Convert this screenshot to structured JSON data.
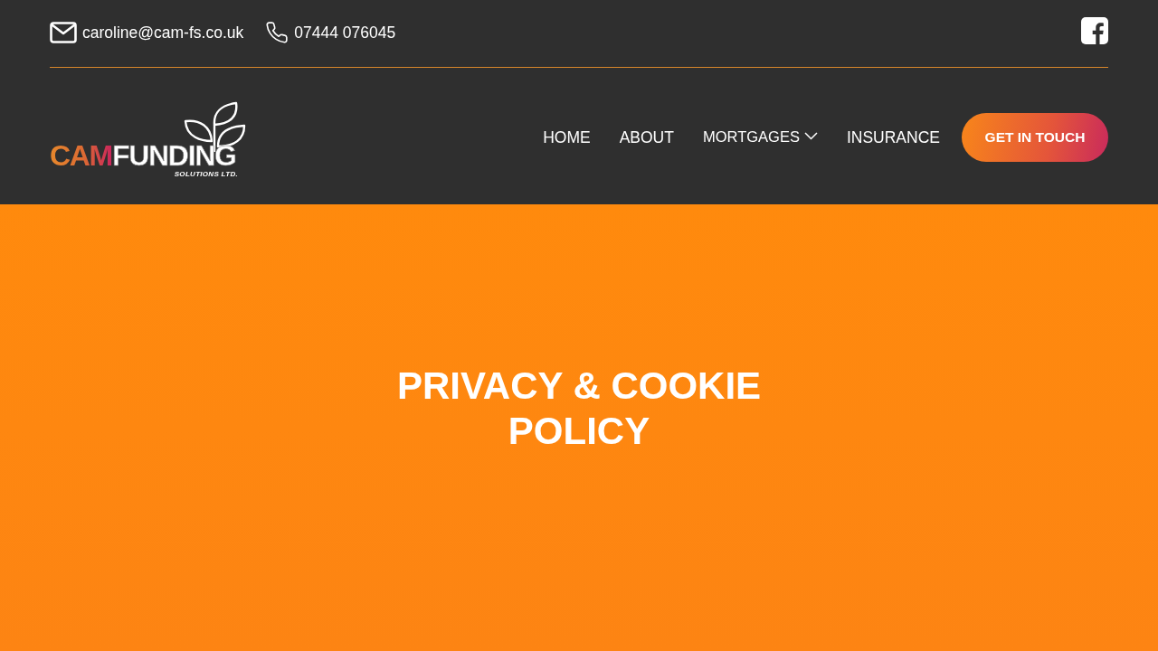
{
  "top_bar": {
    "email": "caroline@cam-fs.co.uk",
    "phone": "07444 076045"
  },
  "header": {
    "logo": {
      "accent_text": "CAM",
      "main_text": "FUNDING",
      "tagline": "SOLUTIONS LTD."
    },
    "nav": [
      {
        "label": "HOME",
        "kind": "link"
      },
      {
        "label": "ABOUT",
        "kind": "link"
      },
      {
        "label": "MORTGAGES",
        "kind": "dropdown"
      },
      {
        "label": "INSURANCE",
        "kind": "link"
      }
    ],
    "cta": "GET IN TOUCH"
  },
  "hero": {
    "title": "PRIVACY & COOKIE POLICY"
  }
}
